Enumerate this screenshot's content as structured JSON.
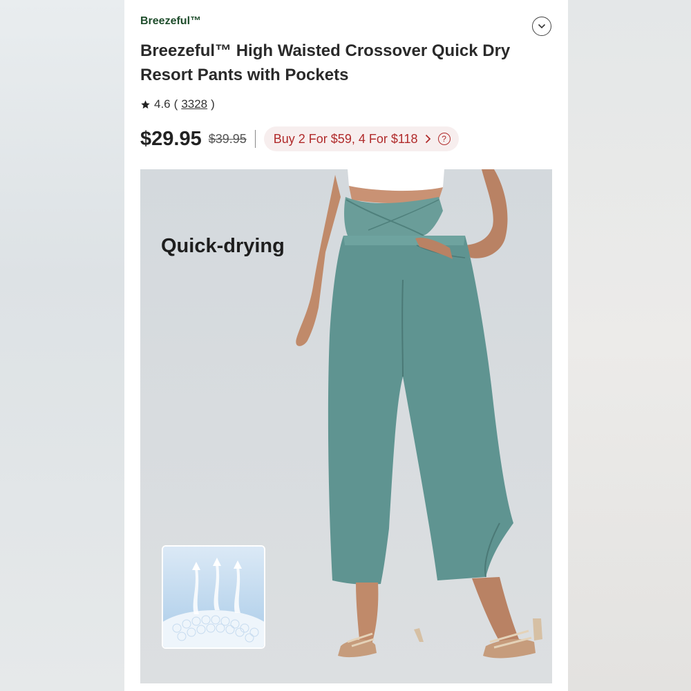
{
  "product": {
    "brand": "Breezeful™",
    "title": "Breezeful™ High Waisted Crossover Quick Dry Resort Pants with Pockets",
    "rating": "4.6",
    "rating_open": "(",
    "review_count": "3328",
    "rating_close": ")",
    "price": "$29.95",
    "original_price": "$39.95",
    "promo": "Buy 2 For $59, 4 For $118",
    "feature_label": "Quick-drying"
  },
  "icons": {
    "collapse": "chevron-down-icon",
    "rating": "star-icon",
    "promo_arrow": "chevron-right-icon",
    "help": "question-circle-icon"
  },
  "colors": {
    "brand": "#1f4d2c",
    "promo_text": "#b02a2a",
    "promo_bg": "#f7eeee",
    "pants": "#5f9491"
  }
}
